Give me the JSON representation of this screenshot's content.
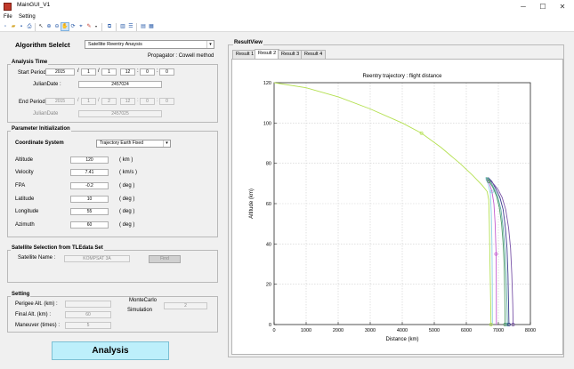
{
  "window": {
    "title": "MainGUI_V1",
    "controls": [
      "─",
      "☐",
      "✕"
    ]
  },
  "menu": [
    "File",
    "Setting"
  ],
  "algorithm": {
    "label": "Algorithm Selelct",
    "selected": "Satellite Reentry Anaysis",
    "propagator": "Propagator : Cowell method"
  },
  "analysis_time": {
    "title": "Analysis Time",
    "start_label": "Start Period :",
    "start": [
      "2015",
      "1",
      "1",
      "12",
      "0",
      "0"
    ],
    "julian_label": "JulianDate :",
    "julian_value": "2457024",
    "end_label": "End Period :",
    "end": [
      "2015",
      "1",
      "2",
      "12",
      "0",
      "0"
    ],
    "julian_end_label": "JulianDate",
    "julian_end_value": "2457025"
  },
  "param_init": {
    "title": "Parameter Initialization",
    "coord_label": "Coordinate System",
    "coord_value": "Trajectory Earth Fixed",
    "rows": [
      {
        "label": "Altitude",
        "value": "120",
        "unit": "( km )"
      },
      {
        "label": "Velocity",
        "value": "7.41",
        "unit": "( km/s )"
      },
      {
        "label": "FPA",
        "value": "-0.2",
        "unit": "( deg )"
      },
      {
        "label": "Latitude",
        "value": "10",
        "unit": "( deg )"
      },
      {
        "label": "Longitude",
        "value": "55",
        "unit": "( deg )"
      },
      {
        "label": "Azimuth",
        "value": "60",
        "unit": "( deg )"
      }
    ]
  },
  "tle": {
    "title": "Satellite Selection from TLEdata Set",
    "name_label": "Satellite Name :",
    "name_value": "KOMPSAT 3A",
    "find_label": "Find"
  },
  "setting": {
    "title": "Setting",
    "perigee_label": "Perigee Alt. (km) :",
    "perigee_value": "",
    "final_label": "Final Alt. (km) :",
    "final_value": "60",
    "maneuver_label": "Maneuver (times) :",
    "maneuver_value": "5",
    "mc_label_1": "MonteCarlo",
    "mc_label_2": "Simulation",
    "mc_value": "2"
  },
  "analysis_button": "Analysis",
  "result": {
    "title": "ResultView",
    "tabs": [
      "Result 1",
      "Result 2",
      "Result 3",
      "Result 4"
    ],
    "selected_tab": 1
  },
  "chart_data": {
    "type": "line",
    "title": "Reentry trajectory : flight distance",
    "xlabel": "Distance (km)",
    "ylabel": "Altitude (km)",
    "xlim": [
      0,
      8000
    ],
    "ylim": [
      0,
      120
    ],
    "xticks": [
      "0",
      "1000",
      "2000",
      "3000",
      "4000",
      "5000",
      "6000",
      "7000",
      "8000"
    ],
    "yticks": [
      "0",
      "20",
      "40",
      "60",
      "80",
      "100",
      "120"
    ],
    "grid": true,
    "series": [
      {
        "color": "#b4e050",
        "points": [
          [
            0,
            120
          ],
          [
            1000,
            117.5
          ],
          [
            2000,
            113
          ],
          [
            3000,
            107
          ],
          [
            4000,
            100
          ],
          [
            4600,
            95
          ],
          [
            5200,
            88
          ],
          [
            5800,
            80
          ],
          [
            6200,
            74
          ],
          [
            6500,
            69
          ],
          [
            6650,
            66
          ],
          [
            6700,
            62
          ],
          [
            6720,
            50
          ],
          [
            6740,
            30
          ],
          [
            6760,
            10
          ],
          [
            6770,
            0
          ]
        ]
      },
      {
        "color": "#8fd0e6",
        "points": [
          [
            6600,
            73
          ],
          [
            6680,
            70
          ],
          [
            6750,
            65
          ],
          [
            6780,
            55
          ],
          [
            6800,
            40
          ],
          [
            6810,
            20
          ],
          [
            6815,
            0
          ]
        ]
      },
      {
        "color": "#c45ccf",
        "points": [
          [
            6640,
            72
          ],
          [
            6720,
            70
          ],
          [
            6800,
            66
          ],
          [
            6860,
            60
          ],
          [
            6900,
            50
          ],
          [
            6920,
            40
          ],
          [
            6930,
            35
          ],
          [
            6935,
            20
          ],
          [
            6940,
            0
          ]
        ]
      },
      {
        "color": "#4d9a66",
        "points": [
          [
            6620,
            73
          ],
          [
            6720,
            71
          ],
          [
            6830,
            68
          ],
          [
            6940,
            64
          ],
          [
            7030,
            58
          ],
          [
            7100,
            50
          ],
          [
            7150,
            40
          ],
          [
            7180,
            30
          ],
          [
            7200,
            15
          ],
          [
            7210,
            0
          ]
        ]
      },
      {
        "color": "#5aa9a0",
        "points": [
          [
            6650,
            73
          ],
          [
            6760,
            71
          ],
          [
            6880,
            67
          ],
          [
            6990,
            63
          ],
          [
            7080,
            57
          ],
          [
            7150,
            48
          ],
          [
            7200,
            38
          ],
          [
            7240,
            25
          ],
          [
            7270,
            10
          ],
          [
            7280,
            0
          ]
        ]
      },
      {
        "color": "#3b3b8f",
        "points": [
          [
            6680,
            73
          ],
          [
            6800,
            71
          ],
          [
            6930,
            67
          ],
          [
            7050,
            63
          ],
          [
            7150,
            57
          ],
          [
            7220,
            48
          ],
          [
            7270,
            38
          ],
          [
            7300,
            25
          ],
          [
            7320,
            10
          ],
          [
            7330,
            0
          ]
        ]
      },
      {
        "color": "#7a54a8",
        "points": [
          [
            6700,
            72
          ],
          [
            6840,
            70
          ],
          [
            6990,
            67
          ],
          [
            7120,
            63
          ],
          [
            7230,
            57
          ],
          [
            7320,
            48
          ],
          [
            7380,
            38
          ],
          [
            7420,
            25
          ],
          [
            7450,
            10
          ],
          [
            7460,
            0
          ]
        ]
      }
    ],
    "markers": [
      {
        "x": 4600,
        "y": 95,
        "color": "#b4e050"
      },
      {
        "x": 6800,
        "y": 66,
        "color": "#8fd0e6"
      },
      {
        "x": 6930,
        "y": 35,
        "color": "#c45ccf"
      },
      {
        "x": 6660,
        "y": 72,
        "color": "#5aa9a0"
      },
      {
        "x": 6700,
        "y": 71,
        "color": "#4d9a66"
      },
      {
        "x": 6770,
        "y": 0,
        "color": "#b4e050"
      },
      {
        "x": 7210,
        "y": 0,
        "color": "#4d9a66"
      },
      {
        "x": 7280,
        "y": 0,
        "color": "#5aa9a0"
      },
      {
        "x": 7330,
        "y": 0,
        "color": "#3b3b8f"
      },
      {
        "x": 7460,
        "y": 0,
        "color": "#7a54a8"
      }
    ]
  }
}
